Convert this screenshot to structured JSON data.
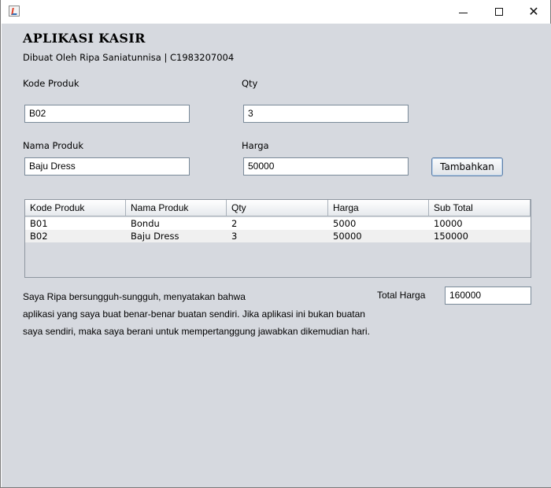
{
  "window": {
    "icon": "java-app-icon",
    "controls": {
      "minimize": "minimize-icon",
      "maximize": "maximize-icon",
      "close": "close-icon"
    }
  },
  "header": {
    "title": "APLIKASI KASIR",
    "subtitle": "Dibuat Oleh Ripa Saniatunnisa | C1983207004"
  },
  "form": {
    "kode_produk": {
      "label": "Kode Produk",
      "value": "B02"
    },
    "qty": {
      "label": "Qty",
      "value": "3"
    },
    "nama_produk": {
      "label": "Nama Produk",
      "value": "Baju Dress"
    },
    "harga": {
      "label": "Harga",
      "value": "50000"
    },
    "add_button": "Tambahkan"
  },
  "table": {
    "columns": [
      "Kode Produk",
      "Nama Produk",
      "Qty",
      "Harga",
      "Sub Total"
    ],
    "rows": [
      [
        "B01",
        "Bondu",
        "2",
        "5000",
        "10000"
      ],
      [
        "B02",
        "Baju Dress",
        "3",
        "50000",
        "150000"
      ]
    ]
  },
  "statement": [
    "Saya Ripa bersungguh-sungguh, menyatakan bahwa",
    "aplikasi yang saya buat benar-benar buatan sendiri. Jika aplikasi ini bukan buatan",
    "saya sendiri, maka saya berani untuk mempertanggung jawabkan dikemudian hari."
  ],
  "total": {
    "label": "Total Harga",
    "value": "160000"
  },
  "colors": {
    "background": "#d6d9df",
    "field_border": "#7a8a99",
    "button_border": "#5f7fa6"
  }
}
